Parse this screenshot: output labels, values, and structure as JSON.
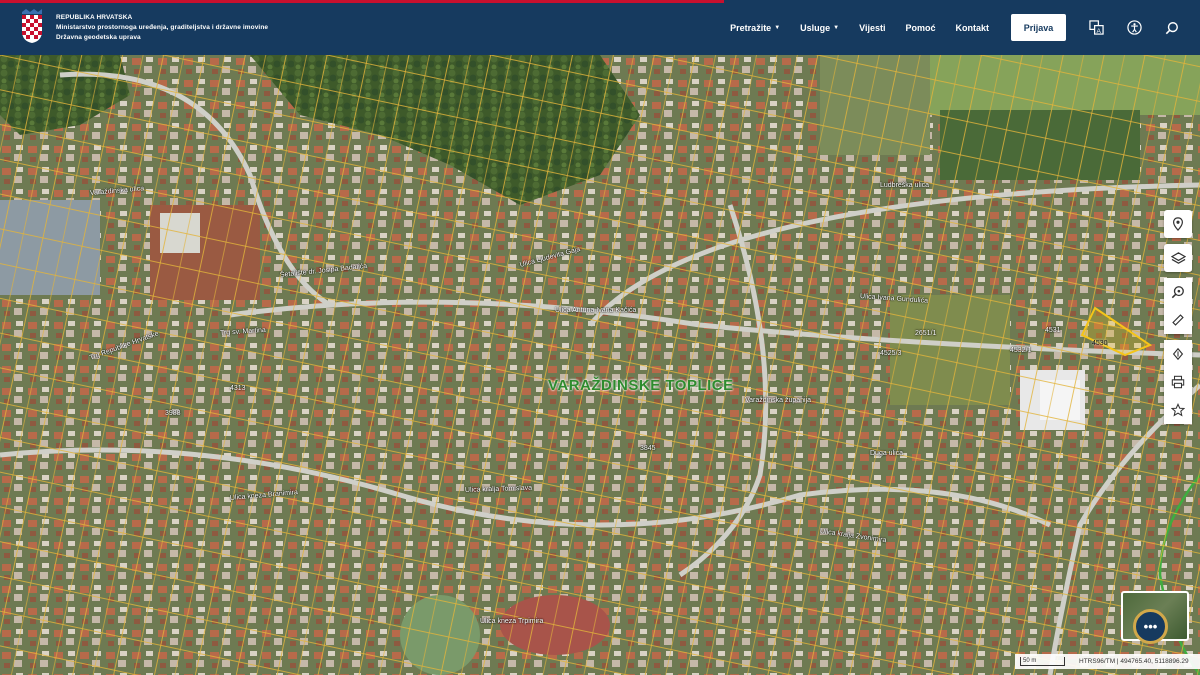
{
  "header": {
    "org_line1": "REPUBLIKA HRVATSKA",
    "org_line2": "Ministarstvo prostornoga uređenja, graditeljstva i državne imovine",
    "org_line3": "Državna geodetska uprava",
    "nav": [
      {
        "label": "Pretražite",
        "dropdown": true
      },
      {
        "label": "Usluge",
        "dropdown": true
      },
      {
        "label": "Vijesti",
        "dropdown": false
      },
      {
        "label": "Pomoć",
        "dropdown": false
      },
      {
        "label": "Kontakt",
        "dropdown": false
      }
    ],
    "login_label": "Prijava",
    "icons": [
      "translate-icon",
      "accessibility-icon",
      "search-icon"
    ]
  },
  "map": {
    "town_label": "VARAŽDINSKE TOPLICE",
    "streets": [
      "Varaždinska ulica",
      "Ludbreška ulica",
      "Ulica Ivana Gundulića",
      "Trg sv. Martina",
      "Ulica kralja Tomislava",
      "Duga ulica",
      "Varaždinska županija",
      "Ulica kneza Branimira",
      "Ulica kneza Trpimira",
      "Ulica Antuna Ivana Kačića",
      "Ulica Ljudevita Gaja",
      "Ulica kralja Zvonimira",
      "Šetalište dr. Josipa Badalića",
      "Trg Republike Hrvatske"
    ],
    "parcel_labels": [
      "4530",
      "4531",
      "4532/1",
      "4313",
      "3988",
      "3845",
      "2651/1",
      "4525/3"
    ]
  },
  "tools": [
    "location-icon",
    "layers-icon",
    "zoom-search-icon",
    "measure-icon",
    "share-icon",
    "print-icon",
    "star-icon"
  ],
  "status": {
    "scale_label": "50 m",
    "coords": "HTRS96/TM | 494765.40, 5118896.29"
  },
  "chat_label": "•••",
  "colors": {
    "header_bg": "#163a5f",
    "accent_red": "#c8102e",
    "parcel_line": "#e2b43a",
    "selected_parcel": "#f5c518"
  }
}
